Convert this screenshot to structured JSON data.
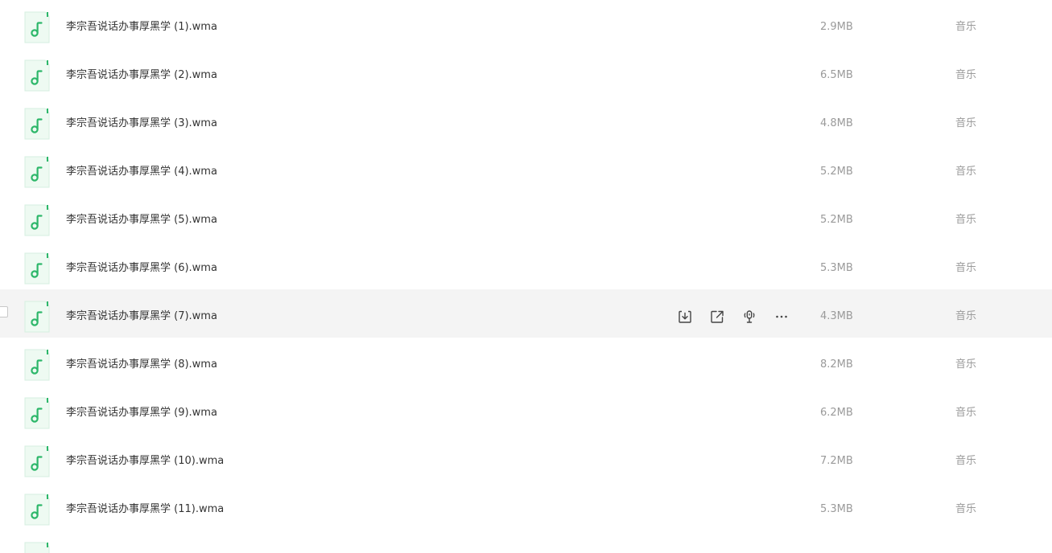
{
  "file_type_icon": "music-note-icon",
  "accent_color": "#2db76a",
  "hover_actions": [
    {
      "name": "download-icon",
      "label": "download"
    },
    {
      "name": "share-icon",
      "label": "share"
    },
    {
      "name": "podcast-icon",
      "label": "play"
    },
    {
      "name": "more-icon",
      "label": "more"
    }
  ],
  "files": [
    {
      "name": "李宗吾说话办事厚黑学 (1).wma",
      "size": "2.9MB",
      "type": "音乐"
    },
    {
      "name": "李宗吾说话办事厚黑学 (2).wma",
      "size": "6.5MB",
      "type": "音乐"
    },
    {
      "name": "李宗吾说话办事厚黑学 (3).wma",
      "size": "4.8MB",
      "type": "音乐"
    },
    {
      "name": "李宗吾说话办事厚黑学 (4).wma",
      "size": "5.2MB",
      "type": "音乐"
    },
    {
      "name": "李宗吾说话办事厚黑学 (5).wma",
      "size": "5.2MB",
      "type": "音乐"
    },
    {
      "name": "李宗吾说话办事厚黑学 (6).wma",
      "size": "5.3MB",
      "type": "音乐"
    },
    {
      "name": "李宗吾说话办事厚黑学 (7).wma",
      "size": "4.3MB",
      "type": "音乐"
    },
    {
      "name": "李宗吾说话办事厚黑学 (8).wma",
      "size": "8.2MB",
      "type": "音乐"
    },
    {
      "name": "李宗吾说话办事厚黑学 (9).wma",
      "size": "6.2MB",
      "type": "音乐"
    },
    {
      "name": "李宗吾说话办事厚黑学 (10).wma",
      "size": "7.2MB",
      "type": "音乐"
    },
    {
      "name": "李宗吾说话办事厚黑学 (11).wma",
      "size": "5.3MB",
      "type": "音乐"
    }
  ]
}
